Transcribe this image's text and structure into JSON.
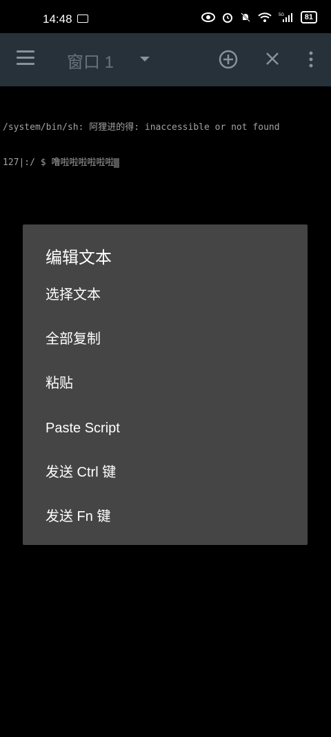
{
  "status_bar": {
    "time": "14:48",
    "battery": "81",
    "network": "5G"
  },
  "toolbar": {
    "window_title": "窗口 1"
  },
  "terminal": {
    "line1": "/system/bin/sh: 阿狸进的得: inaccessible or not found",
    "line2": "127|:/ $ 噜啦啦啦啦啦啦"
  },
  "dialog": {
    "title": "编辑文本",
    "items": [
      {
        "label": "选择文本"
      },
      {
        "label": "全部复制"
      },
      {
        "label": "粘贴"
      },
      {
        "label": "Paste Script"
      },
      {
        "label": "发送 Ctrl 键"
      },
      {
        "label": "发送 Fn 键"
      }
    ]
  }
}
